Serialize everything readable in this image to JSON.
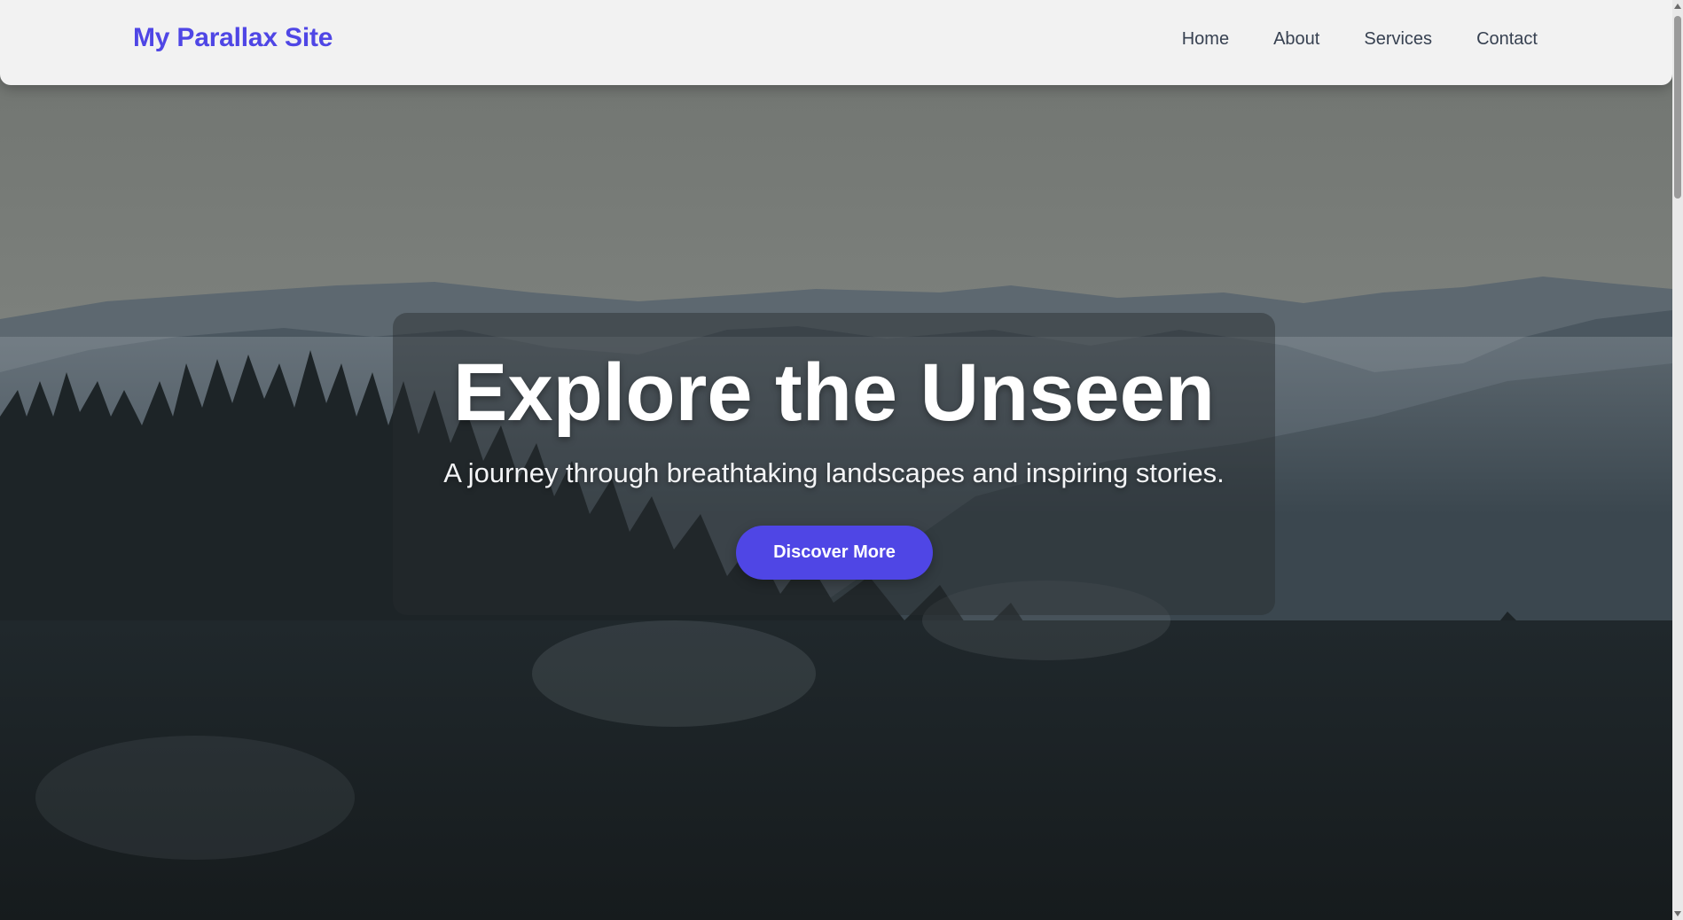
{
  "navbar": {
    "brand": "My Parallax Site",
    "links": [
      {
        "label": "Home"
      },
      {
        "label": "About"
      },
      {
        "label": "Services"
      },
      {
        "label": "Contact"
      }
    ]
  },
  "hero": {
    "title": "Explore the Unseen",
    "subtitle": "A journey through breathtaking landscapes and inspiring stories.",
    "cta_label": "Discover More",
    "background_description_icon": "mountain-forest-image"
  },
  "colors": {
    "accent": "#4f46e5",
    "navbar_bg": "#f2f2f2",
    "nav_text": "#374151"
  }
}
